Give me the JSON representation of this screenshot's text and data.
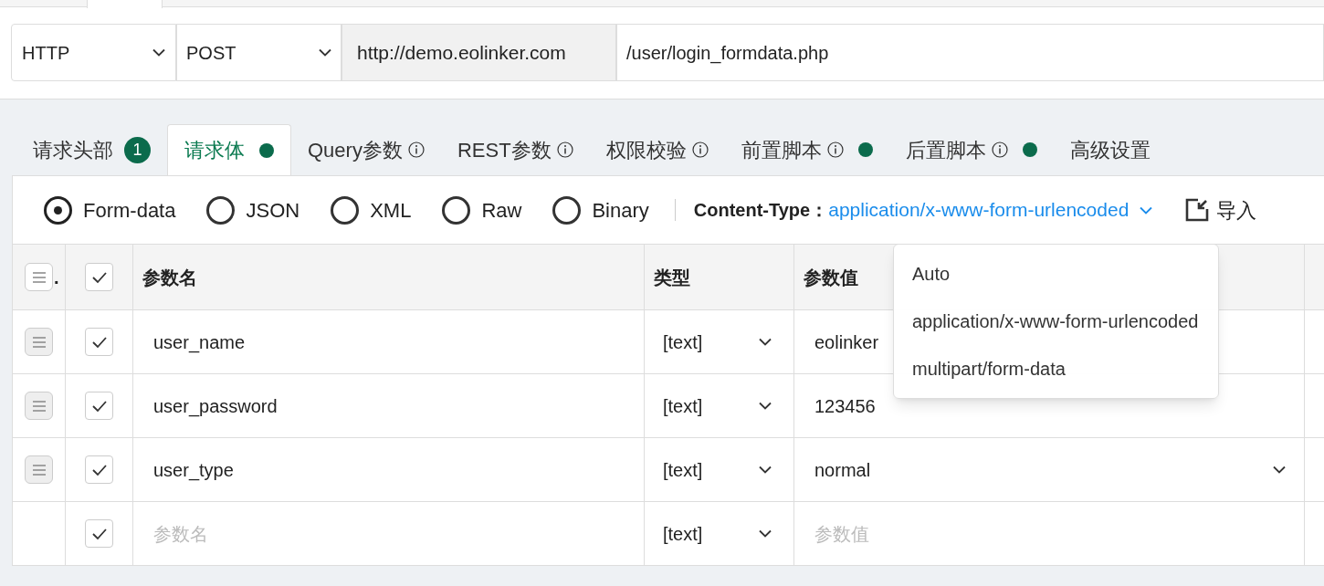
{
  "request_line": {
    "protocol": "HTTP",
    "method": "POST",
    "host": "http://demo.eolinker.com",
    "path": "/user/login_formdata.php"
  },
  "tabs": [
    {
      "label": "请求头部",
      "selected": false,
      "badge": "1",
      "dot": false,
      "info": false
    },
    {
      "label": "请求体",
      "selected": true,
      "dot": true,
      "info": false
    },
    {
      "label": "Query参数",
      "selected": false,
      "dot": false,
      "info": true
    },
    {
      "label": "REST参数",
      "selected": false,
      "dot": false,
      "info": true
    },
    {
      "label": "权限校验",
      "selected": false,
      "dot": false,
      "info": true
    },
    {
      "label": "前置脚本",
      "selected": false,
      "dot": true,
      "info": true
    },
    {
      "label": "后置脚本",
      "selected": false,
      "dot": true,
      "info": true
    },
    {
      "label": "高级设置",
      "selected": false,
      "dot": false,
      "info": false
    }
  ],
  "body_types": [
    {
      "label": "Form-data",
      "selected": true
    },
    {
      "label": "JSON",
      "selected": false
    },
    {
      "label": "XML",
      "selected": false
    },
    {
      "label": "Raw",
      "selected": false
    },
    {
      "label": "Binary",
      "selected": false
    }
  ],
  "content_type": {
    "label": "Content-Type：",
    "value": "application/x-www-form-urlencoded"
  },
  "import_button": "导入",
  "table": {
    "column_1": ".",
    "header_checked": true,
    "columns": [
      "参数名",
      "类型",
      "参数值"
    ],
    "rows": [
      {
        "checked": true,
        "name": "user_name",
        "type": "[text]",
        "value": "eolinker",
        "value_dropdown": false
      },
      {
        "checked": true,
        "name": "user_password",
        "type": "[text]",
        "value": "123456",
        "value_dropdown": false
      },
      {
        "checked": true,
        "name": "user_type",
        "type": "[text]",
        "value": "normal",
        "value_dropdown": true
      }
    ],
    "new_row": {
      "checked": true,
      "name_placeholder": "参数名",
      "type": "[text]",
      "value_placeholder": "参数值"
    }
  },
  "content_type_menu": [
    "Auto",
    "application/x-www-form-urlencoded",
    "multipart/form-data"
  ]
}
